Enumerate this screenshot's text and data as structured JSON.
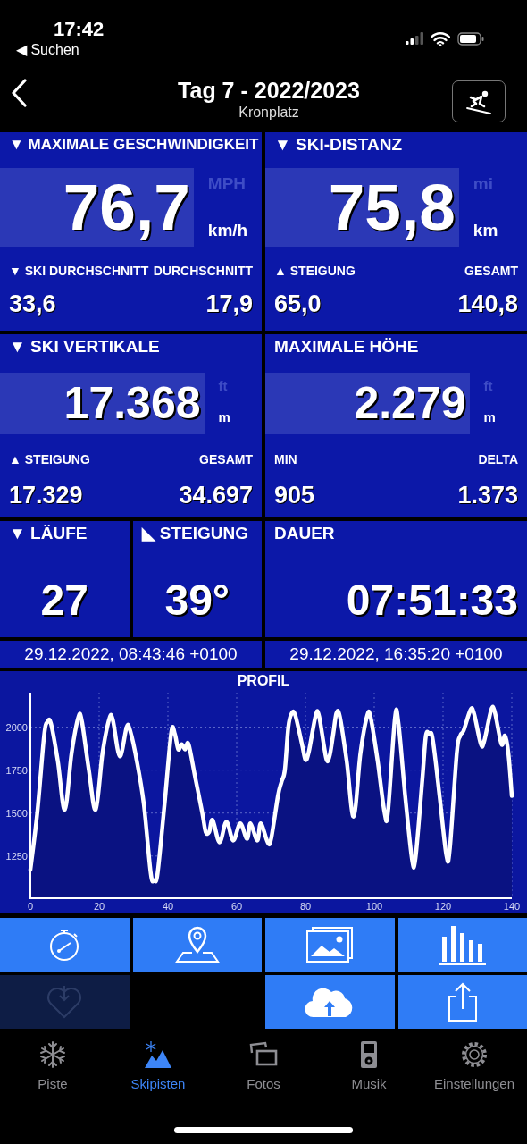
{
  "status_bar": {
    "time": "17:42",
    "back_label": "◀ Suchen"
  },
  "header": {
    "title": "Tag 7 - 2022/2023",
    "subtitle": "Kronplatz"
  },
  "tiles": [
    {
      "kind": "large",
      "title": "▼ MAXIMALE GESCHWINDIGKEIT",
      "value": "76,7",
      "units": [
        {
          "label": "MPH",
          "selected": false
        },
        {
          "label": "km/h",
          "selected": true
        }
      ],
      "sub": [
        {
          "label": "▼ SKI DURCHSCHNITT",
          "value": "33,6"
        },
        {
          "label": "DURCHSCHNITT",
          "value": "17,9"
        }
      ]
    },
    {
      "kind": "large",
      "title": "▼ SKI-DISTANZ",
      "value": "75,8",
      "units": [
        {
          "label": "mi",
          "selected": false
        },
        {
          "label": "km",
          "selected": true
        }
      ],
      "sub": [
        {
          "label": "▲ STEIGUNG",
          "value": "65,0"
        },
        {
          "label": "GESAMT",
          "value": "140,8"
        }
      ]
    },
    {
      "kind": "medium",
      "title": "▼ SKI VERTIKALE",
      "value": "17.368",
      "units": [
        {
          "label": "ft",
          "selected": false
        },
        {
          "label": "m",
          "selected": true
        }
      ],
      "sub": [
        {
          "label": "▲ STEIGUNG",
          "value": "17.329"
        },
        {
          "label": "GESAMT",
          "value": "34.697"
        }
      ]
    },
    {
      "kind": "medium",
      "title": "MAXIMALE HÖHE",
      "value": "2.279",
      "units": [
        {
          "label": "ft",
          "selected": false
        },
        {
          "label": "m",
          "selected": true
        }
      ],
      "sub": [
        {
          "label": "MIN",
          "value": "905"
        },
        {
          "label": "DELTA",
          "value": "1.373"
        }
      ]
    },
    {
      "kind": "count",
      "title": "▼ LÄUFE",
      "value": "27"
    },
    {
      "kind": "count",
      "title": "◣ STEIGUNG",
      "value": "39°"
    },
    {
      "kind": "duration",
      "title": "DAUER",
      "value": "07:51:33"
    }
  ],
  "dates": [
    "29.12.2022, 08:43:46 +0100",
    "29.12.2022, 16:35:20 +0100"
  ],
  "profile": {
    "chart_data": {
      "type": "area",
      "title": "PROFIL",
      "x": [
        0,
        2,
        4,
        5,
        6,
        8,
        10,
        12,
        14,
        15,
        17,
        19,
        21,
        23,
        24,
        26,
        28,
        29,
        31,
        33,
        35,
        36,
        37,
        39,
        41,
        42,
        43,
        44,
        45,
        46,
        48,
        50,
        51,
        52,
        53,
        55,
        57,
        59,
        61,
        63,
        64,
        66,
        67,
        69,
        70,
        72,
        73,
        74,
        75,
        76,
        77,
        79,
        80,
        81,
        83,
        84,
        86,
        87,
        88,
        89,
        90,
        92,
        94,
        96,
        98,
        99,
        101,
        103,
        104,
        106,
        107,
        109,
        111,
        112,
        114,
        115,
        116,
        117,
        119,
        121,
        122,
        124,
        125,
        126,
        128,
        129,
        131,
        132,
        134,
        135,
        137,
        138,
        139,
        140
      ],
      "series": [
        {
          "color": "#ffffff",
          "values": [
            1170,
            1500,
            1950,
            2030,
            2020,
            1800,
            1520,
            1850,
            2060,
            2030,
            1750,
            1520,
            1850,
            2050,
            2040,
            1830,
            2000,
            1980,
            1800,
            1550,
            1150,
            1110,
            1150,
            1550,
            1970,
            1960,
            1870,
            1900,
            1870,
            1900,
            1700,
            1500,
            1390,
            1390,
            1460,
            1330,
            1450,
            1340,
            1440,
            1350,
            1440,
            1340,
            1440,
            1330,
            1350,
            1600,
            1680,
            1750,
            2000,
            2080,
            2070,
            1900,
            1810,
            1860,
            2070,
            2060,
            1820,
            1830,
            1950,
            2080,
            2060,
            1800,
            1480,
            1850,
            2070,
            2050,
            1800,
            1500,
            1510,
            2050,
            2030,
            1600,
            1230,
            1240,
            1700,
            1950,
            1960,
            1930,
            1600,
            1250,
            1300,
            1850,
            1950,
            1980,
            2100,
            2080,
            1900,
            1920,
            2100,
            2090,
            1900,
            1950,
            1850,
            1600
          ]
        }
      ],
      "xlim": [
        0,
        140
      ],
      "ylim": [
        1005,
        2200
      ],
      "xticks": [
        0,
        20,
        40,
        60,
        80,
        100,
        120,
        140
      ],
      "yticks": [
        1250,
        1500,
        1750,
        2000
      ],
      "grid": true
    }
  },
  "actions": [
    {
      "kind": "stopwatch",
      "disabled": false
    },
    {
      "kind": "map",
      "disabled": false
    },
    {
      "kind": "photos",
      "disabled": false
    },
    {
      "kind": "chart",
      "disabled": false
    },
    {
      "kind": "heart",
      "disabled": true
    },
    {
      "kind": "blank"
    },
    {
      "kind": "cloud",
      "disabled": false
    },
    {
      "kind": "share",
      "disabled": false
    }
  ],
  "tabs": [
    {
      "kind": "snowflake",
      "label": "Piste",
      "selected": false
    },
    {
      "kind": "mountain",
      "label": "Skipisten",
      "selected": true
    },
    {
      "kind": "photos",
      "label": "Fotos",
      "selected": false
    },
    {
      "kind": "player",
      "label": "Musik",
      "selected": false
    },
    {
      "kind": "gear",
      "label": "Einstellungen",
      "selected": false
    }
  ]
}
